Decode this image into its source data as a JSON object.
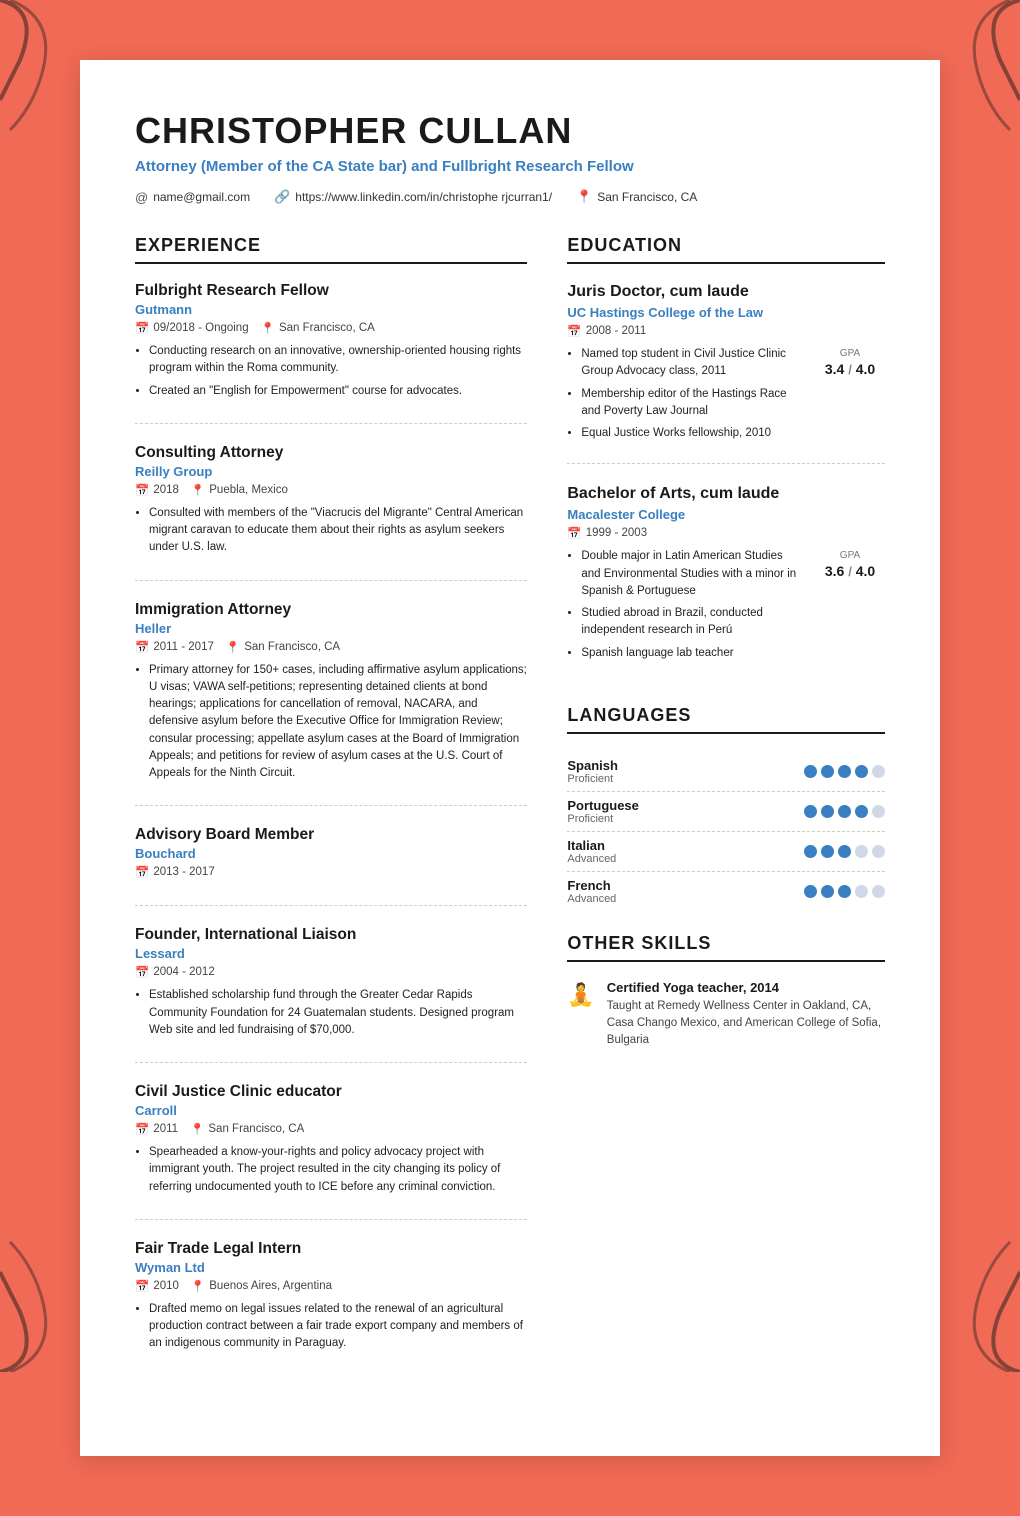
{
  "background_color": "#f06a55",
  "header": {
    "name": "CHRISTOPHER CULLAN",
    "title": "Attorney (Member of the CA State bar) and Fullbright Research Fellow",
    "email": "name@gmail.com",
    "linkedin": "https://www.linkedin.com/in/christophe rjcurran1/",
    "location": "San Francisco, CA"
  },
  "sections": {
    "experience_title": "EXPERIENCE",
    "education_title": "EDUCATION",
    "languages_title": "LANGUAGES",
    "other_skills_title": "OTHER SKILLS"
  },
  "experience": [
    {
      "job_title": "Fulbright Research Fellow",
      "company": "Gutmann",
      "date": "09/2018 - Ongoing",
      "location": "San Francisco, CA",
      "bullets": [
        "Conducting research on an innovative, ownership-oriented housing rights program within the Roma community.",
        "Created an \"English for Empowerment\" course for advocates."
      ]
    },
    {
      "job_title": "Consulting Attorney",
      "company": "Reilly Group",
      "date": "2018",
      "location": "Puebla, Mexico",
      "bullets": [
        "Consulted with members of the \"Viacrucis del Migrante\" Central American migrant caravan to educate them about their rights as asylum seekers under U.S. law."
      ]
    },
    {
      "job_title": "Immigration Attorney",
      "company": "Heller",
      "date": "2011 - 2017",
      "location": "San Francisco, CA",
      "bullets": [
        "Primary attorney for 150+ cases, including affirmative asylum applications; U visas; VAWA self-petitions; representing detained clients at bond hearings; applications for cancellation of removal, NACARA, and defensive asylum before the Executive Office for Immigration Review; consular processing; appellate asylum cases at the Board of Immigration Appeals; and petitions for review of asylum cases at the U.S. Court of Appeals for the Ninth Circuit."
      ]
    },
    {
      "job_title": "Advisory Board Member",
      "company": "Bouchard",
      "date": "2013 - 2017",
      "location": "",
      "bullets": []
    },
    {
      "job_title": "Founder, International Liaison",
      "company": "Lessard",
      "date": "2004 - 2012",
      "location": "",
      "bullets": [
        "Established scholarship fund through the Greater Cedar Rapids Community Foundation for 24 Guatemalan students. Designed program Web site and led fundraising of $70,000."
      ]
    },
    {
      "job_title": "Civil Justice Clinic educator",
      "company": "Carroll",
      "date": "2011",
      "location": "San Francisco, CA",
      "bullets": [
        "Spearheaded a know-your-rights and policy advocacy project with immigrant youth. The project resulted in the city changing its policy of referring undocumented youth to ICE before any criminal conviction."
      ]
    },
    {
      "job_title": "Fair Trade Legal Intern",
      "company": "Wyman Ltd",
      "date": "2010",
      "location": "Buenos Aires, Argentina",
      "bullets": [
        "Drafted memo on legal issues related to the renewal of an agricultural production contract between a fair trade export company and members of an indigenous community in Paraguay."
      ]
    }
  ],
  "education": [
    {
      "degree": "Juris Doctor, cum laude",
      "school": "UC Hastings College of the Law",
      "years": "2008 - 2011",
      "gpa": "3.4",
      "gpa_max": "4.0",
      "bullets": [
        "Named top student in Civil Justice Clinic Group Advocacy class, 2011",
        "Membership editor of the Hastings Race and Poverty Law Journal",
        "Equal Justice Works fellowship, 2010"
      ]
    },
    {
      "degree": "Bachelor of Arts, cum laude",
      "school": "Macalester College",
      "years": "1999 - 2003",
      "gpa": "3.6",
      "gpa_max": "4.0",
      "bullets": [
        "Double major in Latin American Studies and Environmental Studies with a minor in Spanish & Portuguese",
        "Studied abroad in Brazil, conducted independent research in Perú",
        "Spanish language lab teacher"
      ]
    }
  ],
  "languages": [
    {
      "name": "Spanish",
      "level": "Proficient",
      "filled": 4,
      "empty": 1
    },
    {
      "name": "Portuguese",
      "level": "Proficient",
      "filled": 4,
      "empty": 1
    },
    {
      "name": "Italian",
      "level": "Advanced",
      "filled": 3,
      "empty": 2
    },
    {
      "name": "French",
      "level": "Advanced",
      "filled": 3,
      "empty": 2
    }
  ],
  "other_skills": [
    {
      "title": "Certified Yoga teacher, 2014",
      "description": "Taught at Remedy Wellness Center in Oakland, CA, Casa Chango Mexico, and American College of Sofia, Bulgaria",
      "icon": "🧘"
    }
  ]
}
